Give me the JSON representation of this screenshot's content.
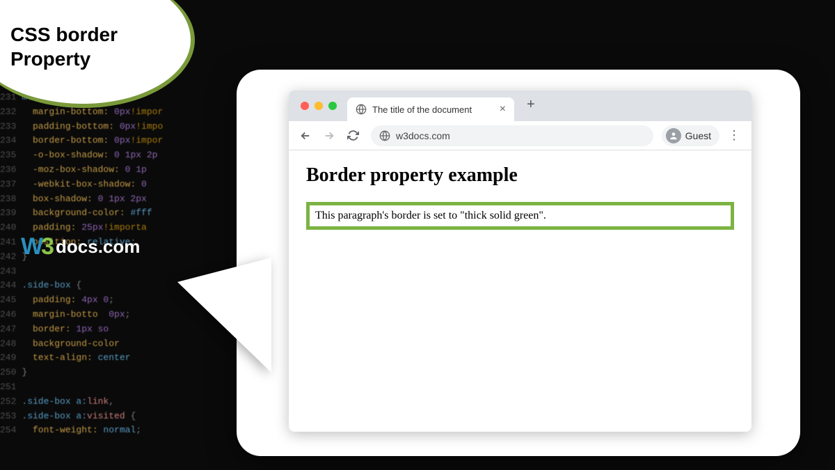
{
  "title": {
    "line1": "CSS border",
    "line2": "Property"
  },
  "logo": {
    "w": "W",
    "three": "3",
    "text": "docs.com"
  },
  "browser": {
    "tab_title": "The title of the document",
    "url": "w3docs.com",
    "guest_label": "Guest"
  },
  "page": {
    "heading": "Border property example",
    "paragraph": "This paragraph's border is set to \"thick solid green\"."
  },
  "code_lines": [
    {
      "ln": "231",
      "text": " ",
      "parts": [
        {
          "c": "sel",
          "t": "mtent-inner"
        },
        {
          "c": "brace",
          "t": " {"
        }
      ]
    },
    {
      "ln": "232",
      "text": " ",
      "parts": [
        {
          "c": "prop",
          "t": "  margin-bottom:"
        },
        {
          "c": "num",
          "t": " 0px"
        },
        {
          "c": "imp",
          "t": "!impor"
        }
      ]
    },
    {
      "ln": "233",
      "text": " ",
      "parts": [
        {
          "c": "prop",
          "t": "  padding-bottom:"
        },
        {
          "c": "num",
          "t": " 0px"
        },
        {
          "c": "imp",
          "t": "!impo"
        }
      ]
    },
    {
      "ln": "234",
      "text": " ",
      "parts": [
        {
          "c": "prop",
          "t": "  border-bottom:"
        },
        {
          "c": "num",
          "t": " 0px"
        },
        {
          "c": "imp",
          "t": "!impor"
        }
      ]
    },
    {
      "ln": "235",
      "text": " ",
      "parts": [
        {
          "c": "prop",
          "t": "  -o-box-shadow:"
        },
        {
          "c": "num",
          "t": " 0 1px 2p"
        }
      ]
    },
    {
      "ln": "236",
      "text": " ",
      "parts": [
        {
          "c": "prop",
          "t": "  -moz-box-shadow:"
        },
        {
          "c": "num",
          "t": " 0 1p"
        }
      ]
    },
    {
      "ln": "237",
      "text": " ",
      "parts": [
        {
          "c": "prop",
          "t": "  -webkit-box-shadow:"
        },
        {
          "c": "num",
          "t": " 0 "
        }
      ]
    },
    {
      "ln": "238",
      "text": " ",
      "parts": [
        {
          "c": "prop",
          "t": "  box-shadow:"
        },
        {
          "c": "num",
          "t": " 0 1px 2px"
        }
      ]
    },
    {
      "ln": "239",
      "text": " ",
      "parts": [
        {
          "c": "prop",
          "t": "  background-color:"
        },
        {
          "c": "val",
          "t": " #fff"
        }
      ]
    },
    {
      "ln": "240",
      "text": " ",
      "parts": [
        {
          "c": "prop",
          "t": "  padding:"
        },
        {
          "c": "num",
          "t": " 25px"
        },
        {
          "c": "imp",
          "t": "!importa"
        }
      ]
    },
    {
      "ln": "241",
      "text": " ",
      "parts": [
        {
          "c": "prop",
          "t": "  position:"
        },
        {
          "c": "val",
          "t": " relative"
        },
        {
          "c": "brace",
          "t": ";"
        }
      ]
    },
    {
      "ln": "242",
      "text": " ",
      "parts": [
        {
          "c": "brace",
          "t": "}"
        }
      ]
    },
    {
      "ln": "243",
      "text": " ",
      "parts": []
    },
    {
      "ln": "244",
      "text": " ",
      "parts": [
        {
          "c": "sel",
          "t": ".side-box"
        },
        {
          "c": "brace",
          "t": " {"
        }
      ]
    },
    {
      "ln": "245",
      "text": " ",
      "parts": [
        {
          "c": "prop",
          "t": "  padding:"
        },
        {
          "c": "num",
          "t": " 4px 0"
        },
        {
          "c": "brace",
          "t": ";"
        }
      ]
    },
    {
      "ln": "246",
      "text": " ",
      "parts": [
        {
          "c": "prop",
          "t": "  margin-botto"
        },
        {
          "c": "num",
          "t": "  0px"
        },
        {
          "c": "brace",
          "t": ";"
        }
      ]
    },
    {
      "ln": "247",
      "text": " ",
      "parts": [
        {
          "c": "prop",
          "t": "  border:"
        },
        {
          "c": "num",
          "t": " 1px so"
        }
      ]
    },
    {
      "ln": "248",
      "text": " ",
      "parts": [
        {
          "c": "prop",
          "t": "  background-color"
        }
      ]
    },
    {
      "ln": "249",
      "text": " ",
      "parts": [
        {
          "c": "prop",
          "t": "  text-align:"
        },
        {
          "c": "val",
          "t": " center"
        }
      ]
    },
    {
      "ln": "250",
      "text": " ",
      "parts": [
        {
          "c": "brace",
          "t": "}"
        }
      ]
    },
    {
      "ln": "251",
      "text": " ",
      "parts": []
    },
    {
      "ln": "252",
      "text": " ",
      "parts": [
        {
          "c": "sel",
          "t": ".side-box a:"
        },
        {
          "c": "kw",
          "t": "link"
        },
        {
          "c": "brace",
          "t": ","
        }
      ]
    },
    {
      "ln": "253",
      "text": " ",
      "parts": [
        {
          "c": "sel",
          "t": ".side-box a:"
        },
        {
          "c": "kw",
          "t": "visited"
        },
        {
          "c": "brace",
          "t": " {"
        }
      ]
    },
    {
      "ln": "254",
      "text": " ",
      "parts": [
        {
          "c": "prop",
          "t": "  font-weight:"
        },
        {
          "c": "val",
          "t": " normal"
        },
        {
          "c": "brace",
          "t": ";"
        }
      ]
    }
  ]
}
